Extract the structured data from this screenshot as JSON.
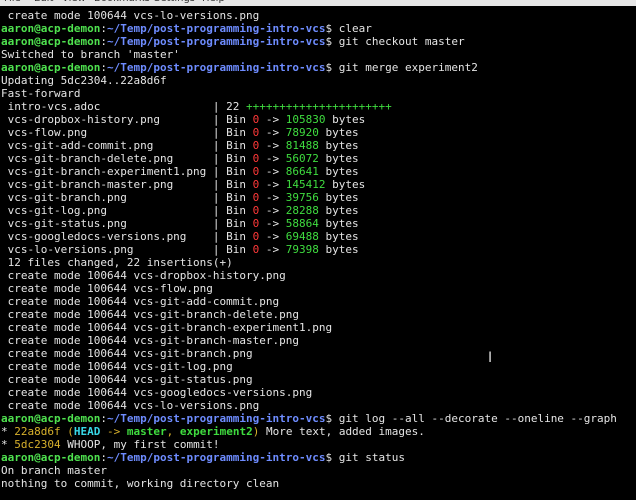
{
  "menubar": {
    "items": [
      "File",
      "Edit",
      "View",
      "Bookmarks",
      "Settings",
      "Help"
    ]
  },
  "prompt": {
    "userhost": "aaron@acp-demon",
    "path": "~/Temp/post-programming-intro-vcs",
    "symbol": "$"
  },
  "terminal": {
    "l0": "create mode 100644 vcs-lo-versions.png",
    "cmd_clear": "clear",
    "cmd_checkout": "git checkout master",
    "switched": "Switched to branch 'master'",
    "cmd_merge": "git merge experiment2",
    "updating": "Updating 5dc2304..22a8d6f",
    "fastforward": "Fast-forward",
    "diffstat": [
      {
        "file": "intro-vcs.adoc",
        "type": "text",
        "count": "22",
        "plus": "++++++++++++++++++++++"
      },
      {
        "file": "vcs-dropbox-history.png",
        "type": "bin",
        "from": "0",
        "to": "105830"
      },
      {
        "file": "vcs-flow.png",
        "type": "bin",
        "from": "0",
        "to": "78920"
      },
      {
        "file": "vcs-git-add-commit.png",
        "type": "bin",
        "from": "0",
        "to": "81488"
      },
      {
        "file": "vcs-git-branch-delete.png",
        "type": "bin",
        "from": "0",
        "to": "56072"
      },
      {
        "file": "vcs-git-branch-experiment1.png",
        "type": "bin",
        "from": "0",
        "to": "86641"
      },
      {
        "file": "vcs-git-branch-master.png",
        "type": "bin",
        "from": "0",
        "to": "145412"
      },
      {
        "file": "vcs-git-branch.png",
        "type": "bin",
        "from": "0",
        "to": "39756"
      },
      {
        "file": "vcs-git-log.png",
        "type": "bin",
        "from": "0",
        "to": "28288"
      },
      {
        "file": "vcs-git-status.png",
        "type": "bin",
        "from": "0",
        "to": "58864"
      },
      {
        "file": "vcs-googledocs-versions.png",
        "type": "bin",
        "from": "0",
        "to": "69488"
      },
      {
        "file": "vcs-lo-versions.png",
        "type": "bin",
        "from": "0",
        "to": "79398"
      }
    ],
    "bin_label": "Bin",
    "arrow": "->",
    "bytes_label": "bytes",
    "summary": "12 files changed, 22 insertions(+)",
    "creates": [
      "create mode 100644 vcs-dropbox-history.png",
      "create mode 100644 vcs-flow.png",
      "create mode 100644 vcs-git-add-commit.png",
      "create mode 100644 vcs-git-branch-delete.png",
      "create mode 100644 vcs-git-branch-experiment1.png",
      "create mode 100644 vcs-git-branch-master.png",
      "create mode 100644 vcs-git-branch.png",
      "create mode 100644 vcs-git-log.png",
      "create mode 100644 vcs-git-status.png",
      "create mode 100644 vcs-googledocs-versions.png",
      "create mode 100644 vcs-lo-versions.png"
    ],
    "cmd_log": "git log --all --decorate --oneline --graph",
    "log1": {
      "star": "*",
      "hash": "22a8d6f",
      "open": "(",
      "head": "HEAD",
      "arrow": "->",
      "master": "master",
      "comma": ",",
      "branch2": "experiment2",
      "close": ")",
      "msg": "More text, added images."
    },
    "log2": {
      "star": "*",
      "hash": "5dc2304",
      "msg": "WHOOP, my first commit!"
    },
    "cmd_status": "git status",
    "status1": "On branch master",
    "status2": "nothing to commit, working directory clean"
  },
  "colors": {
    "background": "#000000",
    "foreground": "#e5e5e5",
    "user_host": "#4fe24f",
    "path": "#6e8cff",
    "diff_plus": "#3fdc3f",
    "bin_from": "#ff3838",
    "bin_to": "#3fdc3f",
    "hash": "#d7b12c",
    "head": "#38d8e8"
  },
  "icons": {
    "cursor": "text-ibeam-cursor"
  }
}
